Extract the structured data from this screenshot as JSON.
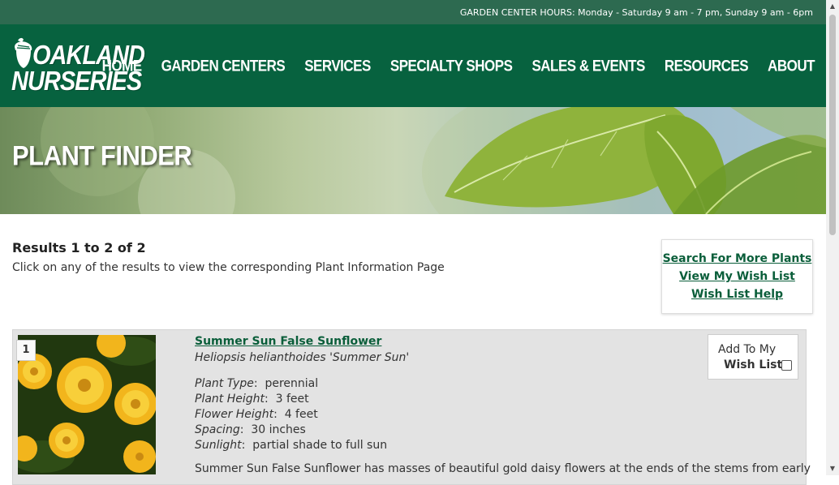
{
  "topbar": {
    "hours": "GARDEN CENTER HOURS: Monday - Saturday 9 am - 7 pm, Sunday 9 am - 6pm"
  },
  "logo": {
    "line1": "OAKLAND",
    "line2": "NURSERIES"
  },
  "nav": [
    "HOME",
    "GARDEN CENTERS",
    "SERVICES",
    "SPECIALTY SHOPS",
    "SALES & EVENTS",
    "RESOURCES",
    "ABOUT"
  ],
  "hero": {
    "title": "PLANT FINDER"
  },
  "results": {
    "title": "Results 1 to 2 of 2",
    "subtitle": "Click on any of the results to view the corresponding Plant Information Page"
  },
  "links": {
    "search_more": "Search For More Plants",
    "view_wish": "View My Wish List",
    "wish_help": "Wish List Help"
  },
  "items": [
    {
      "index": "1",
      "name": "Summer Sun False Sunflower",
      "botanical": "Heliopsis helianthoides 'Summer Sun'",
      "attrs": [
        {
          "label": "Plant Type",
          "value": "perennial"
        },
        {
          "label": "Plant Height",
          "value": "3 feet"
        },
        {
          "label": "Flower Height",
          "value": "4 feet"
        },
        {
          "label": "Spacing",
          "value": "30 inches"
        },
        {
          "label": "Sunlight",
          "value": "partial shade to full sun"
        }
      ],
      "description": "Summer Sun False Sunflower has masses of beautiful gold daisy flowers at the ends of the stems from early",
      "wish_line1": "Add To My",
      "wish_line2": "Wish List"
    }
  ],
  "colors": {
    "header": "#07623f",
    "topbar": "#2d6a50",
    "link": "#0a5e3a"
  }
}
